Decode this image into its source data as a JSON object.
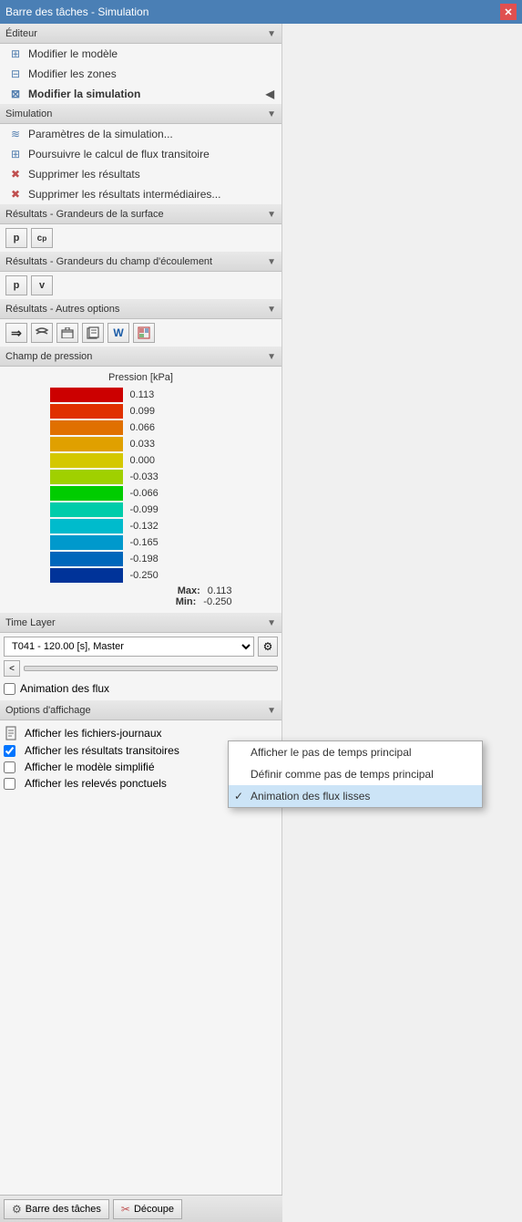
{
  "titleBar": {
    "title": "Barre des tâches - Simulation",
    "closeLabel": "✕"
  },
  "sections": {
    "editeur": {
      "label": "Éditeur",
      "items": [
        {
          "id": "modifier-modele",
          "label": "Modifier le modèle",
          "icon": "⊞"
        },
        {
          "id": "modifier-zones",
          "label": "Modifier les zones",
          "icon": "⊟"
        },
        {
          "id": "modifier-simulation",
          "label": "Modifier la simulation",
          "icon": "⊠",
          "bold": true,
          "arrow": true
        }
      ]
    },
    "simulation": {
      "label": "Simulation",
      "items": [
        {
          "id": "parametres",
          "label": "Paramètres de la simulation...",
          "icon": "≋"
        },
        {
          "id": "poursuivre",
          "label": "Poursuivre le calcul de flux transitoire",
          "icon": "⊞"
        },
        {
          "id": "supprimer",
          "label": "Supprimer les résultats",
          "icon": "✕"
        },
        {
          "id": "supprimer-inter",
          "label": "Supprimer les résultats intermédiaires...",
          "icon": "✕"
        }
      ]
    },
    "resultsSurface": {
      "label": "Résultats - Grandeurs de la surface",
      "buttons": [
        {
          "id": "btn-p-surface",
          "label": "p"
        },
        {
          "id": "btn-cp-surface",
          "label": "cₚ"
        }
      ]
    },
    "resultsFlow": {
      "label": "Résultats - Grandeurs du champ d'écoulement",
      "buttons": [
        {
          "id": "btn-p-flow",
          "label": "p"
        },
        {
          "id": "btn-v-flow",
          "label": "v"
        }
      ]
    },
    "resultsOther": {
      "label": "Résultats - Autres options",
      "buttons": [
        {
          "id": "btn-export1",
          "icon": "⇒"
        },
        {
          "id": "btn-export2",
          "icon": "〜"
        },
        {
          "id": "btn-export3",
          "icon": "✉"
        },
        {
          "id": "btn-export4",
          "icon": "⊞"
        },
        {
          "id": "btn-export5",
          "icon": "W"
        },
        {
          "id": "btn-export6",
          "icon": "📊"
        }
      ]
    },
    "pressure": {
      "label": "Champ de pression",
      "title": "Pression [kPa]",
      "colorScale": [
        {
          "color": "#cc0000",
          "value": "0.113"
        },
        {
          "color": "#e03000",
          "value": "0.099"
        },
        {
          "color": "#e06000",
          "value": "0.066"
        },
        {
          "color": "#e09000",
          "value": "0.033"
        },
        {
          "color": "#d4c800",
          "value": "0.000"
        },
        {
          "color": "#a0d000",
          "value": "-0.033"
        },
        {
          "color": "#00cc00",
          "value": "-0.066"
        },
        {
          "color": "#00ccaa",
          "value": "-0.099"
        },
        {
          "color": "#00bbcc",
          "value": "-0.132"
        },
        {
          "color": "#0099cc",
          "value": "-0.165"
        },
        {
          "color": "#0066bb",
          "value": "-0.198"
        },
        {
          "color": "#003399",
          "value": "-0.250"
        }
      ],
      "maxLabel": "Max:",
      "maxValue": "0.113",
      "minLabel": "Min:",
      "minValue": "-0.250"
    },
    "timeLayer": {
      "label": "Time Layer",
      "dropdownValue": "T041 - 120.00 [s], Master",
      "sliderNavPrev": "<",
      "animationLabel": "Animation des flux"
    },
    "optionsAffichage": {
      "label": "Options d'affichage",
      "items": [
        {
          "id": "fichiers-journaux",
          "label": "Afficher les fichiers-journaux",
          "icon": "📄",
          "checked": false
        },
        {
          "id": "resultats-transitoires",
          "label": "Afficher les résultats transitoires",
          "icon": "✓",
          "checked": true
        },
        {
          "id": "modele-simplifie",
          "label": "Afficher le modèle simplifié",
          "icon": "",
          "checked": false
        },
        {
          "id": "releves-ponctuels",
          "label": "Afficher les relevés ponctuels",
          "icon": "",
          "checked": false
        }
      ]
    }
  },
  "contextMenu": {
    "items": [
      {
        "id": "ctx-afficher-pas",
        "label": "Afficher le pas de temps principal",
        "checked": false
      },
      {
        "id": "ctx-definir-pas",
        "label": "Définir comme pas de temps principal",
        "checked": false
      },
      {
        "id": "ctx-animation-flux",
        "label": "Animation des flux lisses",
        "checked": true
      }
    ]
  },
  "bottomBar": {
    "barreBtn": "Barre des tâches",
    "decoupeBtn": "Découpe"
  }
}
